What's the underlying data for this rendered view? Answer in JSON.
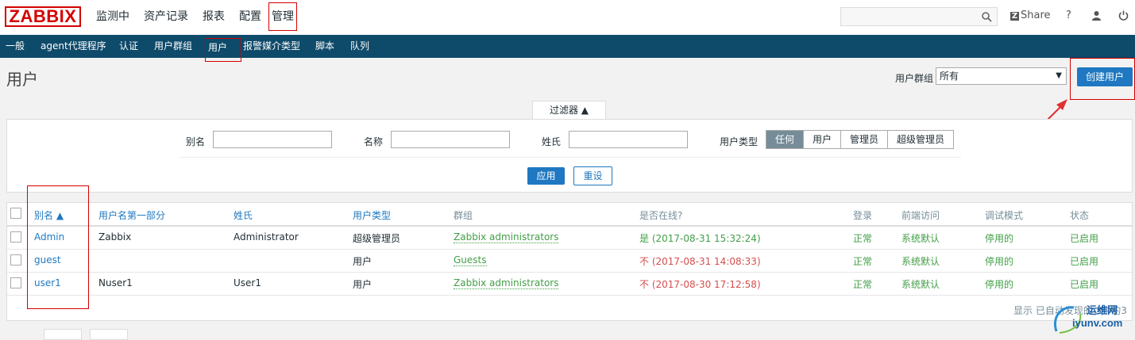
{
  "brand": {
    "logo": "ZABBIX",
    "accent": "#d40000"
  },
  "main_nav": [
    {
      "label": "监测中"
    },
    {
      "label": "资产记录"
    },
    {
      "label": "报表"
    },
    {
      "label": "配置"
    },
    {
      "label": "管理",
      "active": true
    }
  ],
  "top_right": {
    "share": "Share",
    "help": "?",
    "user_icon": "user-icon",
    "logout_icon": "power-icon",
    "search_icon": "search-icon"
  },
  "sub_nav": [
    {
      "label": "一般"
    },
    {
      "label": "agent代理程序"
    },
    {
      "label": "认证"
    },
    {
      "label": "用户群组"
    },
    {
      "label": "用户",
      "active": true
    },
    {
      "label": "报警媒介类型"
    },
    {
      "label": "脚本"
    },
    {
      "label": "队列"
    }
  ],
  "page": {
    "title": "用户",
    "group_label": "用户群组",
    "group_value": "所有",
    "create_button": "创建用户"
  },
  "filter": {
    "tab_label": "过滤器 ▲",
    "alias_label": "别名",
    "alias_value": "",
    "name_label": "名称",
    "name_value": "",
    "surname_label": "姓氏",
    "surname_value": "",
    "type_label": "用户类型",
    "type_options": [
      "任何",
      "用户",
      "管理员",
      "超级管理员"
    ],
    "type_selected": "任何",
    "apply": "应用",
    "reset": "重设"
  },
  "table": {
    "headers": [
      "别名 ▲",
      "用户名第一部分",
      "姓氏",
      "用户类型",
      "群组",
      "是否在线?",
      "登录",
      "前端访问",
      "调试模式",
      "状态"
    ],
    "rows": [
      {
        "alias": "Admin",
        "name": "Zabbix",
        "surname": "Administrator",
        "type": "超级管理员",
        "group": "Zabbix administrators",
        "online": "是 (2017-08-31 15:32:24)",
        "login": "正常",
        "frontend": "系统默认",
        "debug": "停用的",
        "status": "已启用"
      },
      {
        "alias": "guest",
        "name": "",
        "surname": "",
        "type": "用户",
        "group": "Guests",
        "online": "不 (2017-08-31 14:08:33)",
        "login": "正常",
        "frontend": "系统默认",
        "debug": "停用的",
        "status": "已启用"
      },
      {
        "alias": "user1",
        "name": "Nuser1",
        "surname": "User1",
        "type": "用户",
        "group": "Zabbix administrators",
        "online": "不 (2017-08-30 17:12:58)",
        "login": "正常",
        "frontend": "系统默认",
        "debug": "停用的",
        "status": "已启用"
      }
    ],
    "footer": "显示 已自动发现的 3中的3",
    "colors": {
      "link": "#1f78c1",
      "green": "#429e47",
      "red": "#d64e4e"
    }
  },
  "watermark": {
    "text_top": "运维网",
    "text_bottom": "iyunv.com"
  }
}
